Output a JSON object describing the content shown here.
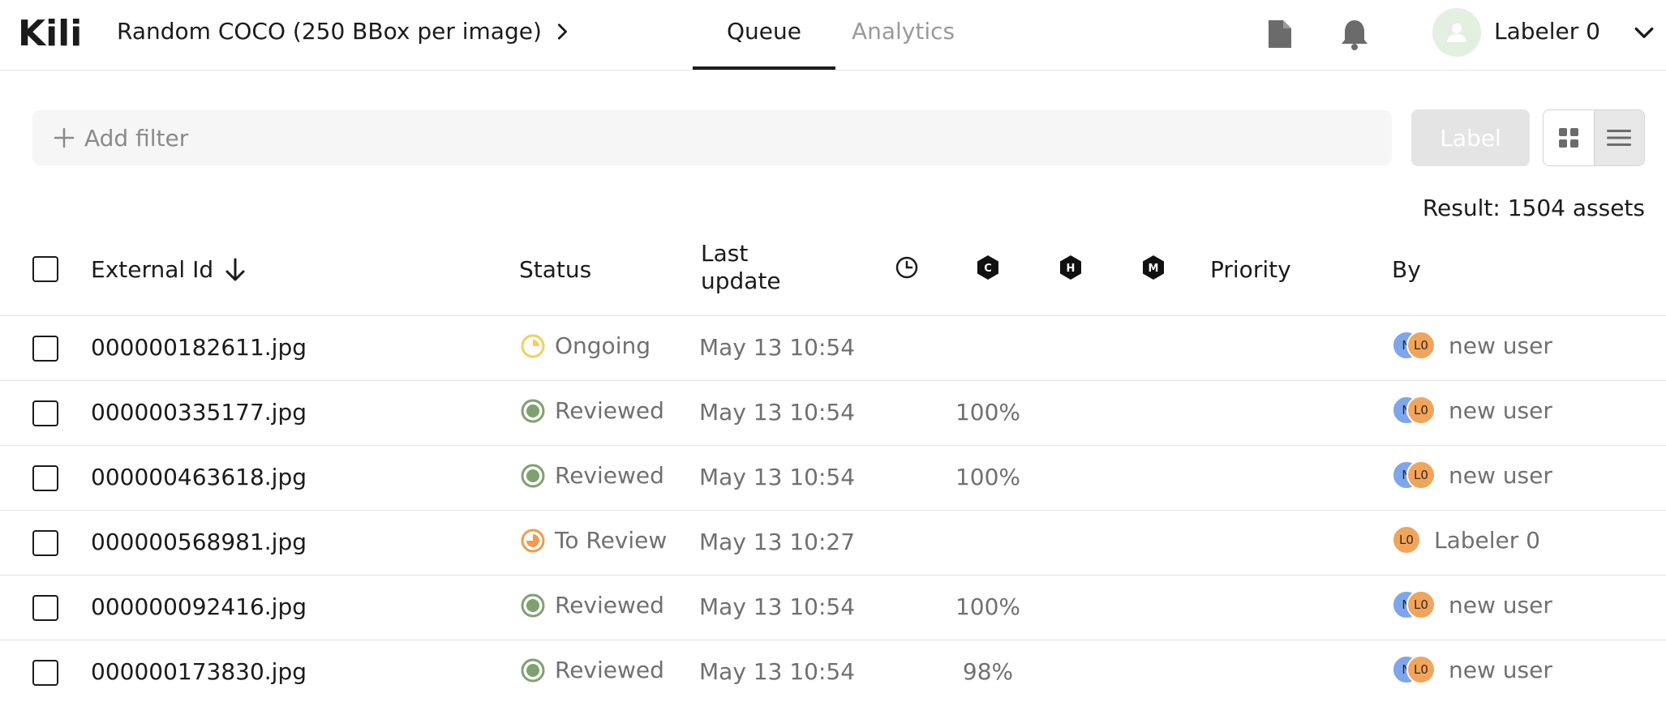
{
  "header": {
    "logo_text": "Kili",
    "project_title": "Random COCO (250 BBox per image)",
    "tabs": [
      {
        "label": "Queue",
        "active": true
      },
      {
        "label": "Analytics",
        "active": false
      }
    ],
    "user": {
      "name": "Labeler 0"
    },
    "icons": [
      "file-icon",
      "bell-icon",
      "user-icon",
      "chevron-down-icon"
    ]
  },
  "toolbar": {
    "filter_placeholder": "Add filter",
    "label_button": "Label",
    "view_modes": [
      "grid-view-icon",
      "list-view-icon"
    ],
    "active_view": "list"
  },
  "result_text": "Result: 1504 assets",
  "table": {
    "columns": {
      "external_id": "External Id",
      "status": "Status",
      "last_update": "Last update",
      "priority": "Priority",
      "by": "By",
      "icon_columns": [
        "clock-icon",
        "C",
        "H",
        "M"
      ]
    },
    "rows": [
      {
        "id": "000000182611.jpg",
        "status": "Ongoing",
        "status_type": "ongoing",
        "updated": "May 13 10:54",
        "consensus": "",
        "by_initials": [
          "N",
          "L0"
        ],
        "by": "new user"
      },
      {
        "id": "000000335177.jpg",
        "status": "Reviewed",
        "status_type": "reviewed",
        "updated": "May 13 10:54",
        "consensus": "100%",
        "by_initials": [
          "N",
          "L0"
        ],
        "by": "new user"
      },
      {
        "id": "000000463618.jpg",
        "status": "Reviewed",
        "status_type": "reviewed",
        "updated": "May 13 10:54",
        "consensus": "100%",
        "by_initials": [
          "N",
          "L0"
        ],
        "by": "new user"
      },
      {
        "id": "000000568981.jpg",
        "status": "To Review",
        "status_type": "to-review",
        "updated": "May 13 10:27",
        "consensus": "",
        "by_initials": [
          "L0"
        ],
        "by": "Labeler 0"
      },
      {
        "id": "000000092416.jpg",
        "status": "Reviewed",
        "status_type": "reviewed",
        "updated": "May 13 10:54",
        "consensus": "100%",
        "by_initials": [
          "N",
          "L0"
        ],
        "by": "new user"
      },
      {
        "id": "000000173830.jpg",
        "status": "Reviewed",
        "status_type": "reviewed",
        "updated": "May 13 10:54",
        "consensus": "98%",
        "by_initials": [
          "N",
          "L0"
        ],
        "by": "new user"
      }
    ]
  },
  "colors": {
    "reviewed": "#7fa16f",
    "ongoing": "#f2cf5b",
    "to_review": "#ef9c4f",
    "avatar_blue": "#7ea6e8",
    "avatar_orange": "#f0a55c"
  }
}
